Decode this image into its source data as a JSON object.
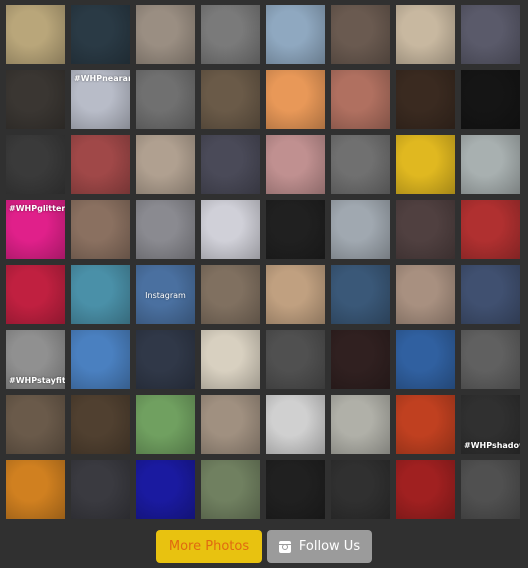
{
  "photos": [
    {
      "tag": "",
      "color": "#b9a67a"
    },
    {
      "tag": "",
      "color": "#2a3a45"
    },
    {
      "tag": "",
      "color": "#9a8e82"
    },
    {
      "tag": "",
      "color": "#7a7a7a"
    },
    {
      "tag": "",
      "color": "#8fa8c0"
    },
    {
      "tag": "",
      "color": "#6a5a50"
    },
    {
      "tag": "",
      "color": "#c8b8a0"
    },
    {
      "tag": "",
      "color": "#5a5a6a"
    },
    {
      "tag": "",
      "color": "#3a3632"
    },
    {
      "tag": "#WHPnearandfar",
      "tag_pos": "top",
      "color": "#b8bcc8"
    },
    {
      "tag": "",
      "color": "#707070"
    },
    {
      "tag": "",
      "color": "#6a5a48"
    },
    {
      "tag": "",
      "color": "#e89858"
    },
    {
      "tag": "",
      "color": "#b07060"
    },
    {
      "tag": "",
      "color": "#3a2a20"
    },
    {
      "tag": "",
      "color": "#151515"
    },
    {
      "tag": "",
      "color": "#3a3a3a"
    },
    {
      "tag": "",
      "color": "#a04848"
    },
    {
      "tag": "",
      "color": "#b0a090"
    },
    {
      "tag": "",
      "color": "#4a4a58"
    },
    {
      "tag": "",
      "color": "#c09090"
    },
    {
      "tag": "",
      "color": "#707070"
    },
    {
      "tag": "",
      "color": "#e0b820"
    },
    {
      "tag": "",
      "color": "#a8b0b0"
    },
    {
      "tag": "#WHPglitter",
      "tag_pos": "top",
      "color": "#e0208a"
    },
    {
      "tag": "",
      "color": "#8a7060"
    },
    {
      "tag": "",
      "color": "#8a8a90"
    },
    {
      "tag": "",
      "color": "#d0d0d8"
    },
    {
      "tag": "",
      "color": "#202020"
    },
    {
      "tag": "",
      "color": "#a0a8b0"
    },
    {
      "tag": "",
      "color": "#504040"
    },
    {
      "tag": "",
      "color": "#b03030"
    },
    {
      "tag": "",
      "color": "#c02040"
    },
    {
      "tag": "",
      "color": "#4a90a8"
    },
    {
      "tag": "Instagram",
      "tag_pos": "center",
      "color": "#4a70a0"
    },
    {
      "tag": "",
      "color": "#807060"
    },
    {
      "tag": "",
      "color": "#c0a080"
    },
    {
      "tag": "",
      "color": "#3a5878"
    },
    {
      "tag": "",
      "color": "#a89080"
    },
    {
      "tag": "",
      "color": "#405070"
    },
    {
      "tag": "#WHPstayfit",
      "tag_pos": "bottom",
      "color": "#909090"
    },
    {
      "tag": "",
      "color": "#4a80c0"
    },
    {
      "tag": "",
      "color": "#303848"
    },
    {
      "tag": "",
      "color": "#d8d0c0"
    },
    {
      "tag": "",
      "color": "#505050"
    },
    {
      "tag": "",
      "color": "#302020"
    },
    {
      "tag": "",
      "color": "#3060a0"
    },
    {
      "tag": "",
      "color": "#606060"
    },
    {
      "tag": "",
      "color": "#6a5a4a"
    },
    {
      "tag": "",
      "color": "#504030"
    },
    {
      "tag": "",
      "color": "#70a060"
    },
    {
      "tag": "",
      "color": "#a09080"
    },
    {
      "tag": "",
      "color": "#d0d0d0"
    },
    {
      "tag": "",
      "color": "#b0b0a8"
    },
    {
      "tag": "",
      "color": "#c04020"
    },
    {
      "tag": "#WHPshadowplay",
      "tag_pos": "bottom",
      "color": "#303030"
    },
    {
      "tag": "",
      "color": "#d08020"
    },
    {
      "tag": "",
      "color": "#3a3a40"
    },
    {
      "tag": "",
      "color": "#1a1aa0"
    },
    {
      "tag": "",
      "color": "#708060"
    },
    {
      "tag": "",
      "color": "#202020"
    },
    {
      "tag": "",
      "color": "#303030"
    },
    {
      "tag": "",
      "color": "#a02020"
    },
    {
      "tag": "",
      "color": "#505050"
    }
  ],
  "buttons": {
    "more_photos": "More Photos",
    "follow_us": "Follow Us",
    "follow_icon": "instagram-icon"
  },
  "colors": {
    "background": "#303030",
    "more_bg": "#e8c210",
    "more_text": "#e06a10",
    "follow_bg": "#9b9b9b"
  }
}
